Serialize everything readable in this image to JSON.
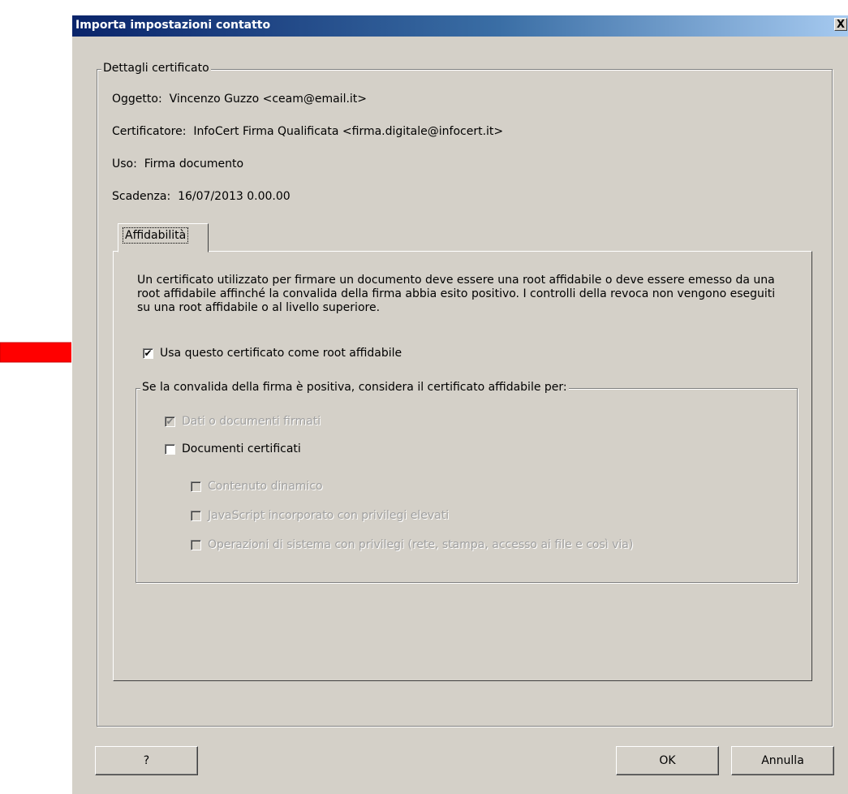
{
  "dialog": {
    "title": "Importa impostazioni contatto",
    "close_label": "X"
  },
  "certificate": {
    "group_label": "Dettagli certificato",
    "subject_label": "Oggetto:",
    "subject_value": "Vincenzo Guzzo <ceam@email.it>",
    "issuer_label": "Certificatore:",
    "issuer_value": "InfoCert Firma Qualificata <firma.digitale@infocert.it>",
    "usage_label": "Uso:",
    "usage_value": "Firma documento",
    "expiry_label": "Scadenza:",
    "expiry_value": "16/07/2013 0.00.00"
  },
  "tabs": [
    {
      "label": "Affidabilità",
      "selected": true
    }
  ],
  "trust": {
    "description": "Un certificato utilizzato per firmare un documento deve essere una root affidabile o deve essere emesso da una root affidabile affinché la convalida della firma abbia esito positivo. I controlli della revoca non vengono eseguiti su una root affidabile o al livello superiore.",
    "root_checkbox": {
      "label": "Usa questo certificato come root affidabile",
      "checked": true
    },
    "group_label": "Se la convalida della firma è positiva, considera il certificato affidabile per:",
    "options": [
      {
        "label": "Dati o documenti firmati",
        "checked": true,
        "enabled": false
      },
      {
        "label": "Documenti certificati",
        "checked": false,
        "enabled": true
      }
    ],
    "sub_options": [
      {
        "label": "Contenuto dinamico",
        "checked": false,
        "enabled": false
      },
      {
        "label": "JavaScript incorporato con privilegi elevati",
        "checked": false,
        "enabled": false
      },
      {
        "label": "Operazioni di sistema con privilegi (rete, stampa, accesso ai file e così via)",
        "checked": false,
        "enabled": false
      }
    ]
  },
  "buttons": {
    "help": "?",
    "ok": "OK",
    "cancel": "Annulla"
  },
  "annotation": {
    "arrow_color": "#ff0000",
    "icon": "red-arrow-icon"
  },
  "colors": {
    "dialog_bg": "#d4d0c8",
    "title_start": "#0a246a",
    "title_end": "#a6caf0"
  }
}
